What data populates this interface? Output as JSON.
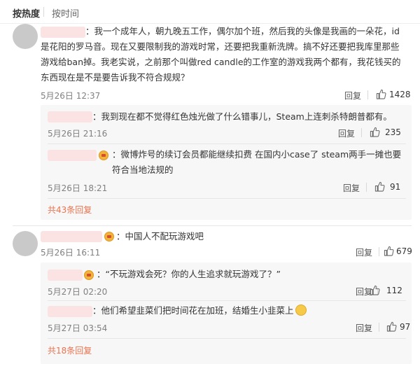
{
  "sort": {
    "hot_label": "按热度",
    "time_label": "按时间"
  },
  "comments": [
    {
      "text": "：我一个成年人，朝九晚五工作，偶尔加个班，然后我的头像是我画的一朵花，id是花阳的罗马音。现在又要限制我的游戏时常，还要把我重新洗牌。搞不好还要把我库里那些游戏给ban掉。我老实说，之前那个叫做red candle的工作室的游戏我两个都有，我花钱买的东西现在是不是要告诉我不符合规规？",
      "time": "5月26日 12:37",
      "reply_label": "回复",
      "likes": "1428",
      "replies": [
        {
          "text": "：我到现在都不觉得红色烛光做了什么错事儿，Steam上连刺杀特朗普都有。",
          "time": "5月26日 21:16",
          "reply_label": "回复",
          "likes": "235"
        },
        {
          "text": "：微博炸号的续订会员都能继续扣费 在国内小case了 steam两手一摊也要符合当地法规的",
          "time": "5月26日 18:21",
          "reply_label": "回复",
          "likes": "91"
        }
      ],
      "more_replies": "共43条回复"
    },
    {
      "text": "：中国人不配玩游戏吧",
      "time": "5月26日 16:11",
      "reply_label": "回复",
      "likes": "679",
      "replies": [
        {
          "text": "：“不玩游戏会死？你的人生追求就玩游戏了？”",
          "time": "5月27日 02:20",
          "reply_label": "回复",
          "likes": "112"
        },
        {
          "text": "：他们希望韭菜们把时间花在加班，结婚生小韭菜上",
          "time": "5月27日 03:54",
          "reply_label": "回复",
          "likes": "97"
        }
      ],
      "more_replies": "共18条回复"
    }
  ]
}
